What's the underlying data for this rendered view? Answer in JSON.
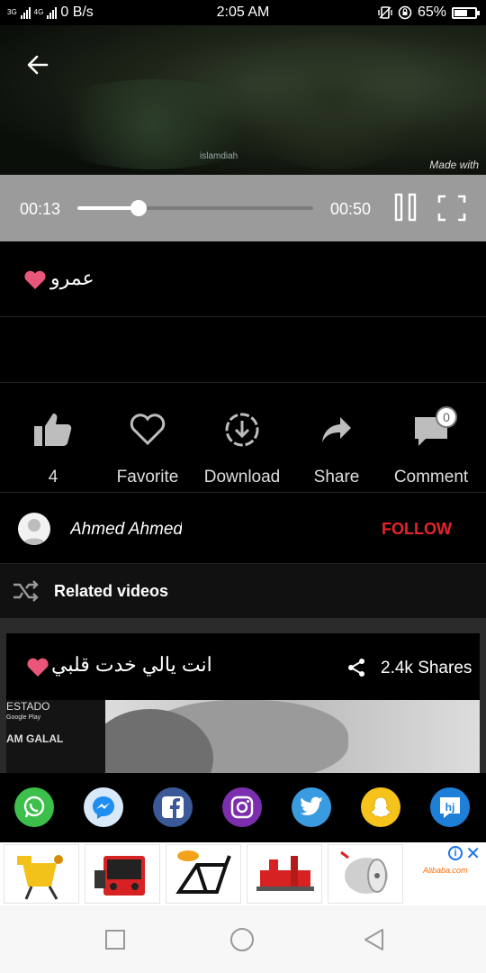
{
  "status_bar": {
    "network_left": "3G",
    "network_right": "4G",
    "speed": "0 B/s",
    "time": "2:05 AM",
    "battery": "65%",
    "battery_level": 0.65
  },
  "video": {
    "watermark_left": "islamdiah",
    "watermark_right": "Made with"
  },
  "player": {
    "current_time": "00:13",
    "duration": "00:50",
    "progress": 0.26
  },
  "post": {
    "title": "عمرو"
  },
  "actions": {
    "likes": "4",
    "favorite": "Favorite",
    "download": "Download",
    "share": "Share",
    "comment": "Comment",
    "comment_count": "0"
  },
  "author": {
    "name": "Ahmed Ahmed",
    "follow": "FOLLOW"
  },
  "related": {
    "header": "Related videos",
    "cards": [
      {
        "title": "انت يالي خدت قلبي",
        "shares": "2.4k Shares",
        "thumb_text_top": "ESTADO",
        "thumb_text_mid": "Google Play",
        "thumb_text_bottom": "AM GALAL"
      }
    ]
  },
  "social_share": [
    "whatsapp",
    "messenger",
    "facebook",
    "instagram",
    "twitter",
    "snapchat",
    "hj"
  ],
  "ads": {
    "brand": "Alibaba.com",
    "info": "i",
    "close": "✕"
  },
  "colors": {
    "accent_heart": "#e8577a",
    "follow": "#e8232a",
    "controls_bg": "#9b9b9b"
  }
}
